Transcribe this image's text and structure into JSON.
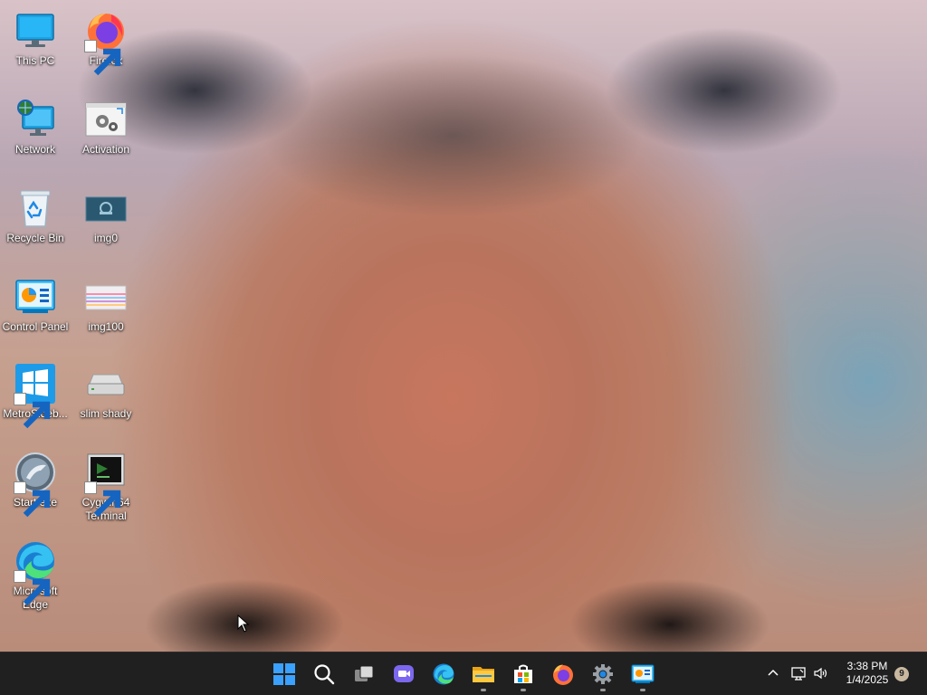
{
  "desktop": {
    "icons": [
      {
        "label": "This PC",
        "icon": "this-pc-icon",
        "shortcut": false
      },
      {
        "label": "Firefox",
        "icon": "firefox-icon",
        "shortcut": true
      },
      {
        "label": "Network",
        "icon": "network-icon",
        "shortcut": false
      },
      {
        "label": "Activation",
        "icon": "activation-icon",
        "shortcut": true
      },
      {
        "label": "Recycle Bin",
        "icon": "recycle-bin-icon",
        "shortcut": false
      },
      {
        "label": "img0",
        "icon": "image-file-icon",
        "shortcut": false
      },
      {
        "label": "Control Panel",
        "icon": "control-panel-icon",
        "shortcut": false
      },
      {
        "label": "img100",
        "icon": "image-file-icon",
        "shortcut": false
      },
      {
        "label": "MetroSideb...",
        "icon": "metro-sidebar-icon",
        "shortcut": true
      },
      {
        "label": "slim shady",
        "icon": "drive-icon",
        "shortcut": false
      },
      {
        "label": "Start.exe",
        "icon": "start-exe-icon",
        "shortcut": true
      },
      {
        "label": "Cygwin64 Terminal",
        "icon": "terminal-icon",
        "shortcut": true
      },
      {
        "label": "Microsoft Edge",
        "icon": "edge-icon",
        "shortcut": true
      }
    ]
  },
  "taskbar": {
    "apps": [
      {
        "name": "start",
        "icon": "windows-start-icon",
        "running": false
      },
      {
        "name": "search",
        "icon": "search-icon",
        "running": false
      },
      {
        "name": "task-view",
        "icon": "task-view-icon",
        "running": false
      },
      {
        "name": "chat",
        "icon": "chat-icon",
        "running": false
      },
      {
        "name": "edge",
        "icon": "edge-icon",
        "running": false
      },
      {
        "name": "file-explorer",
        "icon": "folder-icon",
        "running": true
      },
      {
        "name": "store",
        "icon": "store-icon",
        "running": true
      },
      {
        "name": "firefox",
        "icon": "firefox-icon",
        "running": false
      },
      {
        "name": "settings",
        "icon": "settings-gear-icon",
        "running": true
      },
      {
        "name": "control-panel",
        "icon": "control-panel-icon",
        "running": true
      }
    ],
    "tray": {
      "overflow_icon": "chevron-up-icon",
      "network_icon": "network-status-icon",
      "volume_icon": "volume-icon",
      "time": "3:38 PM",
      "date": "1/4/2025",
      "notification_count": "9"
    }
  },
  "colors": {
    "taskbar": "#202020",
    "accent": "#0078d4",
    "text": "#ffffff"
  }
}
